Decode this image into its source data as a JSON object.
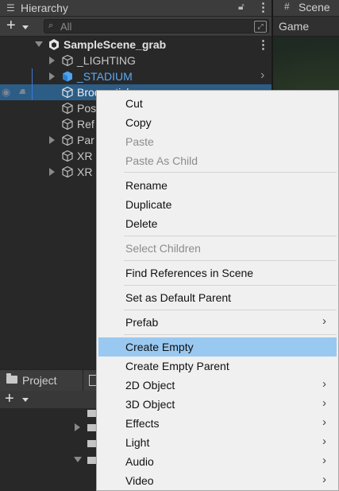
{
  "hierarchy": {
    "title": "Hierarchy",
    "search_placeholder": "All",
    "scene_name": "SampleScene_grab",
    "items": [
      {
        "label": "_LIGHTING"
      },
      {
        "label": "_STADIUM"
      },
      {
        "label": "Broomstick"
      },
      {
        "label": "Pos"
      },
      {
        "label": "Ref"
      },
      {
        "label": "Par"
      },
      {
        "label": "XR"
      },
      {
        "label": "XR"
      }
    ]
  },
  "scene": {
    "tab_label": "Scene",
    "game_label": "Game"
  },
  "project": {
    "tab_label": "Project"
  },
  "context_menu": {
    "cut": "Cut",
    "copy": "Copy",
    "paste": "Paste",
    "paste_as_child": "Paste As Child",
    "rename": "Rename",
    "duplicate": "Duplicate",
    "delete": "Delete",
    "select_children": "Select Children",
    "find_references": "Find References in Scene",
    "set_default_parent": "Set as Default Parent",
    "prefab": "Prefab",
    "create_empty": "Create Empty",
    "create_empty_parent": "Create Empty Parent",
    "object_2d": "2D Object",
    "object_3d": "3D Object",
    "effects": "Effects",
    "light": "Light",
    "audio": "Audio",
    "video": "Video"
  },
  "colors": {
    "selection": "#2c5d87",
    "menu_highlight": "#99c9f0",
    "prefab_blue": "#4da3f0"
  }
}
